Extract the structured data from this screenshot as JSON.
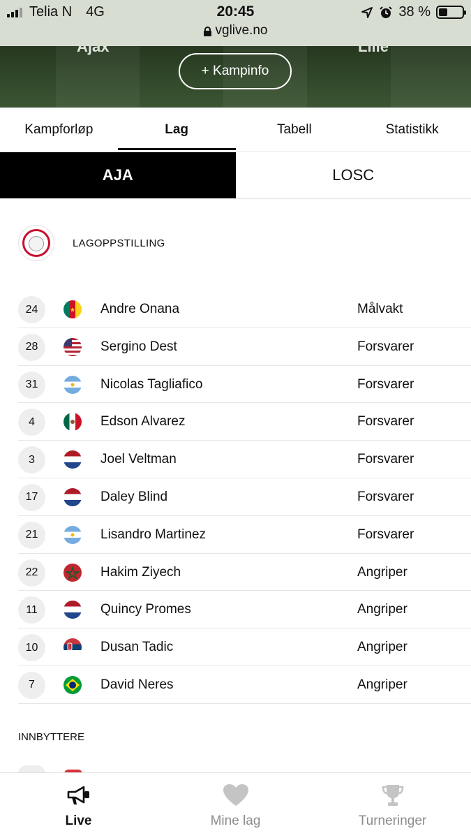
{
  "status_bar": {
    "carrier": "Telia N",
    "network": "4G",
    "time": "20:45",
    "battery": "38 %",
    "battery_level": 0.38,
    "url": "vglive.no"
  },
  "hero": {
    "home_team_partial": "Ajax",
    "away_team_partial": "Lille",
    "kampinfo_label": "+ Kampinfo"
  },
  "tabs": [
    {
      "label": "Kampforløp",
      "active": false
    },
    {
      "label": "Lag",
      "active": true
    },
    {
      "label": "Tabell",
      "active": false
    },
    {
      "label": "Statistikk",
      "active": false
    }
  ],
  "team_switch": [
    {
      "label": "AJA",
      "active": true
    },
    {
      "label": "LOSC",
      "active": false
    }
  ],
  "lineup": {
    "title": "LAGOPPSTILLING",
    "players": [
      {
        "number": "24",
        "name": "Andre Onana",
        "position": "Målvakt",
        "flag": "cameroon"
      },
      {
        "number": "28",
        "name": "Sergino Dest",
        "position": "Forsvarer",
        "flag": "usa"
      },
      {
        "number": "31",
        "name": "Nicolas Tagliafico",
        "position": "Forsvarer",
        "flag": "argentina"
      },
      {
        "number": "4",
        "name": "Edson Alvarez",
        "position": "Forsvarer",
        "flag": "mexico"
      },
      {
        "number": "3",
        "name": "Joel Veltman",
        "position": "Forsvarer",
        "flag": "netherlands"
      },
      {
        "number": "17",
        "name": "Daley Blind",
        "position": "Forsvarer",
        "flag": "netherlands"
      },
      {
        "number": "21",
        "name": "Lisandro Martinez",
        "position": "Forsvarer",
        "flag": "argentina"
      },
      {
        "number": "22",
        "name": "Hakim Ziyech",
        "position": "Angriper",
        "flag": "morocco"
      },
      {
        "number": "11",
        "name": "Quincy Promes",
        "position": "Angriper",
        "flag": "netherlands"
      },
      {
        "number": "10",
        "name": "Dusan Tadic",
        "position": "Angriper",
        "flag": "serbia"
      },
      {
        "number": "7",
        "name": "David Neres",
        "position": "Angriper",
        "flag": "brazil"
      }
    ]
  },
  "substitutes": {
    "title": "INNBYTTERE"
  },
  "bottom_nav": [
    {
      "label": "Live",
      "icon": "megaphone-icon",
      "active": true
    },
    {
      "label": "Mine lag",
      "icon": "heart-icon",
      "active": false
    },
    {
      "label": "Turneringer",
      "icon": "trophy-icon",
      "active": false
    }
  ]
}
